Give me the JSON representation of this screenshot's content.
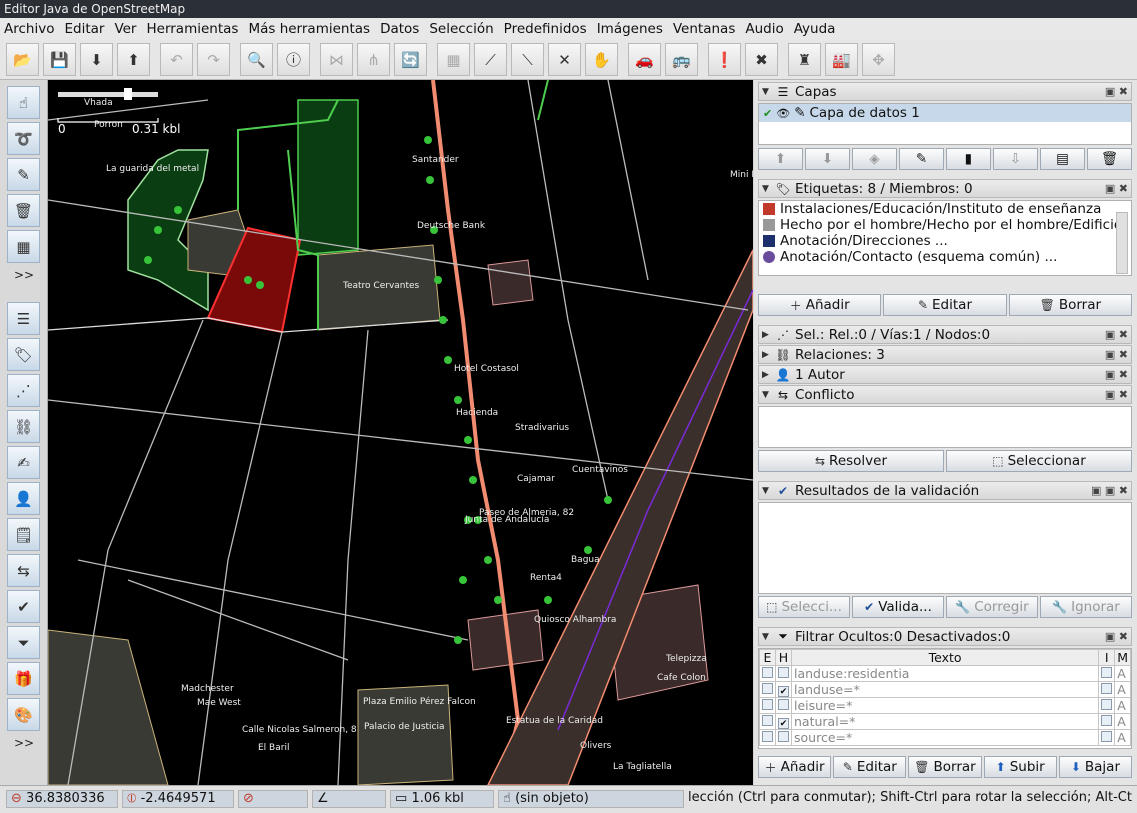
{
  "window": {
    "title": "Editor Java de OpenStreetMap"
  },
  "menu": [
    "Archivo",
    "Editar",
    "Ver",
    "Herramientas",
    "Más herramientas",
    "Datos",
    "Selección",
    "Predefinidos",
    "Imágenes",
    "Ventanas",
    "Audio",
    "Ayuda"
  ],
  "map": {
    "scale_label": "0.31 kbl",
    "scale_zero": "0",
    "labels": {
      "vhada": "Vhada",
      "porron": "Porron",
      "la_guarida": "La guarida del metal",
      "santander": "Santander",
      "deutsche_bank": "Deutsche Bank",
      "teatro_cervantes": "Teatro Cervantes",
      "hotel_costasol": "Hotel Costasol",
      "hacienda": "Hacienda",
      "stradivarius": "Stradivarius",
      "cuentavinos": "Cuentavinos",
      "cajamar": "Cajamar",
      "paseo_almeria": "Paseo de Almeria, 82",
      "junta": "Junta de Andalucía",
      "bagua": "Bagua",
      "renta4": "Renta4",
      "quiosco": "Quiosco Alhambra",
      "madchester": "Madchester",
      "mae_west": "Mae West",
      "plaza_emilio": "Plaza Emilio Pérez Falcon",
      "palacio_justicia": "Palacio de Justicia",
      "calle_nicolas": "Calle Nicolas Salmeron, 8",
      "el_baril": "El Baril",
      "estatua": "Estatua de la Caridad",
      "telepizza": "Telepizza",
      "cafe_colon": "Cafe Colon",
      "olivers": "Olivers",
      "la_tagliatella": "La Tagliatella",
      "mini_b": "Mini B"
    }
  },
  "panels": {
    "layers": {
      "title": "Capas",
      "layer_name": "Capa de datos 1"
    },
    "tags": {
      "title": "Etiquetas: 8 / Miembros: 0",
      "items": [
        "Instalaciones/Educación/Instituto de enseñanza",
        "Hecho por el hombre/Hecho por el hombre/Edificio",
        "Anotación/Direcciones ...",
        "Anotación/Contacto (esquema común) ..."
      ],
      "buttons": {
        "add": "Añadir",
        "edit": "Editar",
        "delete": "Borrar"
      }
    },
    "selection": {
      "title": "Sel.: Rel.:0 / Vías:1 / Nodos:0"
    },
    "relations": {
      "title": "Relaciones: 3"
    },
    "authors": {
      "title": "1 Autor"
    },
    "conflict": {
      "title": "Conflicto",
      "buttons": {
        "resolve": "Resolver",
        "select": "Seleccionar"
      }
    },
    "validation": {
      "title": "Resultados de la validación",
      "buttons": {
        "select": "Selecci...",
        "validate": "Valida...",
        "fix": "Corregir",
        "ignore": "Ignorar"
      }
    },
    "filter": {
      "title": "Filtrar Ocultos:0 Desactivados:0",
      "columns": {
        "e": "E",
        "h": "H",
        "text": "Texto",
        "i": "I",
        "m": "M"
      },
      "rows": [
        {
          "text": "landuse:residentia",
          "e": false,
          "h": false,
          "m": "A"
        },
        {
          "text": "landuse=*",
          "e": false,
          "h": true,
          "m": "A"
        },
        {
          "text": "leisure=*",
          "e": false,
          "h": false,
          "m": "A"
        },
        {
          "text": "natural=*",
          "e": false,
          "h": true,
          "m": "A"
        },
        {
          "text": "source=*",
          "e": false,
          "h": false,
          "m": "A"
        }
      ],
      "buttons": {
        "add": "Añadir",
        "edit": "Editar",
        "delete": "Borrar",
        "up": "Subir",
        "down": "Bajar"
      }
    }
  },
  "status": {
    "lat": "36.8380336",
    "lon": "-2.4649571",
    "distance": "1.06 kbl",
    "object": "(sin objeto)",
    "message": "lección (Ctrl para conmutar); Shift-Ctrl para rotar la selección; Alt-Ctrl"
  },
  "colors": {
    "accent": "#2e5f9e",
    "selected_area": "#7a0a0a",
    "park": "#0b3d12",
    "road_major": "#f28c70"
  }
}
